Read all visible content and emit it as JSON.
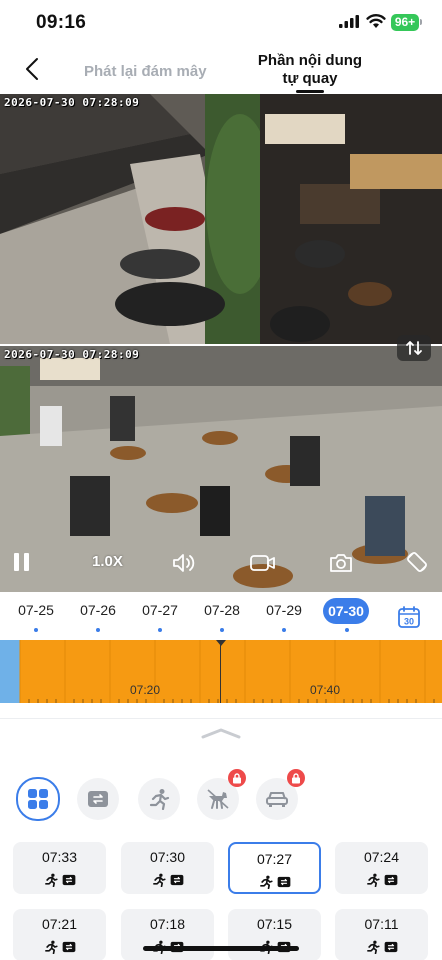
{
  "status_bar": {
    "time": "09:16",
    "battery": "96+"
  },
  "header": {
    "tab_cloud": "Phát lại đám mây",
    "tab_local_line1": "Phần nội dung",
    "tab_local_line2": "tự quay"
  },
  "camera": {
    "feed_top_timestamp": "2026-07-30 07:28:09",
    "feed_bottom_timestamp": "2026-07-30 07:28:09",
    "zoom": "1.0X"
  },
  "dates": [
    "07-25",
    "07-26",
    "07-27",
    "07-28",
    "07-29",
    "07-30"
  ],
  "selected_date": "07-30",
  "calendar_day": "30",
  "timeline": {
    "labels": [
      "07:20",
      "07:40"
    ],
    "bar_color": "#f69a12",
    "start_color": "#6fb1e8"
  },
  "filters": [
    {
      "name": "all",
      "icon": "grid-icon",
      "active": true,
      "locked": false
    },
    {
      "name": "playback",
      "icon": "playback-icon",
      "active": false,
      "locked": false
    },
    {
      "name": "person",
      "icon": "person-running-icon",
      "active": false,
      "locked": false
    },
    {
      "name": "pet",
      "icon": "pet-icon",
      "active": false,
      "locked": true
    },
    {
      "name": "vehicle",
      "icon": "car-icon",
      "active": false,
      "locked": true
    }
  ],
  "events": [
    {
      "time": "07:33",
      "selected": false
    },
    {
      "time": "07:30",
      "selected": false
    },
    {
      "time": "07:27",
      "selected": true
    },
    {
      "time": "07:24",
      "selected": false
    },
    {
      "time": "07:21",
      "selected": false
    },
    {
      "time": "07:18",
      "selected": false
    },
    {
      "time": "07:15",
      "selected": false
    },
    {
      "time": "07:11",
      "selected": false
    }
  ],
  "colors": {
    "accent": "#3b7de9",
    "timeline": "#f69a12",
    "lock": "#ee4a4a"
  }
}
